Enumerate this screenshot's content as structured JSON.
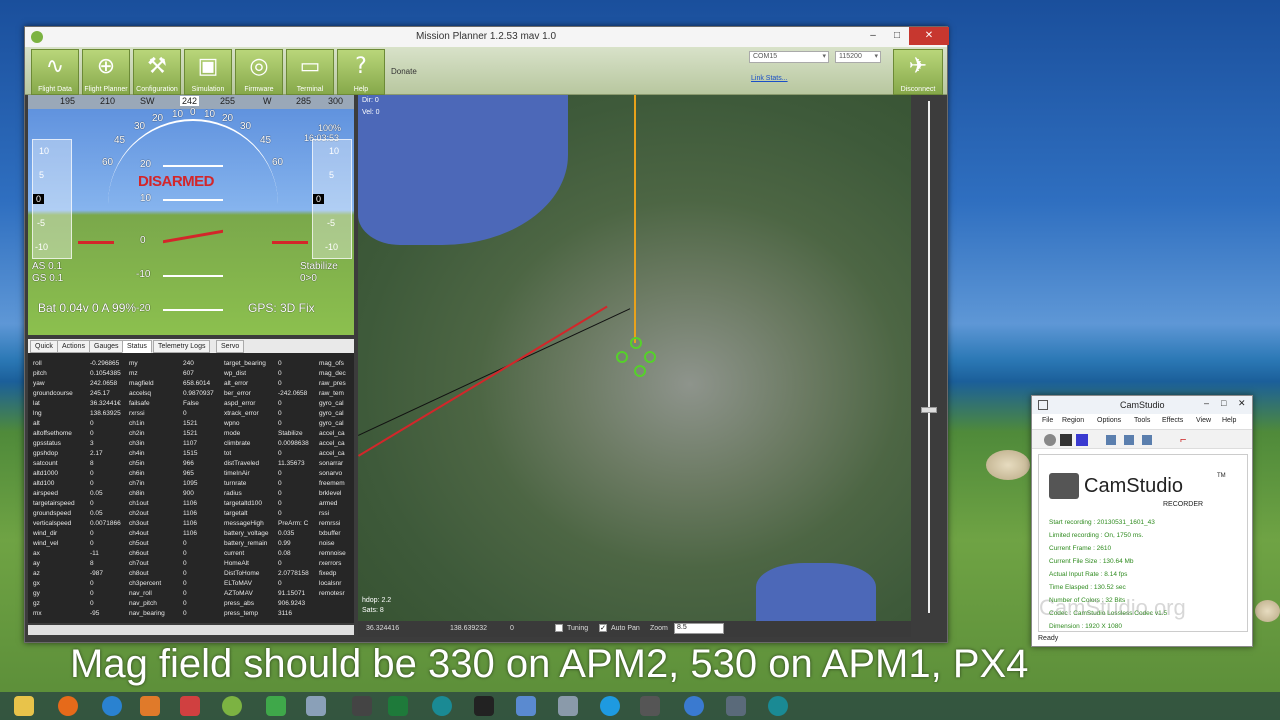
{
  "window": {
    "title": "Mission Planner 1.2.53 mav 1.0",
    "controls": [
      "–",
      "□",
      "✕"
    ]
  },
  "toolbar": {
    "buttons": [
      {
        "label": "Flight Data",
        "icon": "flight-data-icon"
      },
      {
        "label": "Flight Planner",
        "icon": "flight-planner-icon"
      },
      {
        "label": "Configuration",
        "icon": "wrench-icon"
      },
      {
        "label": "Simulation",
        "icon": "simulation-icon"
      },
      {
        "label": "Firmware",
        "icon": "disc-icon"
      },
      {
        "label": "Terminal",
        "icon": "terminal-icon"
      },
      {
        "label": "Help",
        "icon": "help-icon"
      }
    ],
    "donate": "Donate",
    "port": "COM15",
    "baud": "115200",
    "link_stats": "Link Stats...",
    "disconnect": "Disconnect"
  },
  "hud": {
    "heading_ticks": [
      "195",
      "210",
      "SW",
      "242",
      "255",
      "W",
      "285",
      "300"
    ],
    "roll_ticks": [
      "60",
      "45",
      "30",
      "20",
      "10",
      "0",
      "10",
      "20",
      "30",
      "45",
      "60"
    ],
    "pitch_ticks": [
      "20",
      "10",
      "0",
      "-10",
      "-20"
    ],
    "left_tape": [
      "10",
      "5",
      "0",
      "-5",
      "-10"
    ],
    "right_tape": [
      "10",
      "5",
      "0",
      "-5",
      "-10"
    ],
    "battery_pct_top": "100%",
    "time": "16:03:53",
    "disarmed": "DISARMED",
    "as": "AS 0.1",
    "gs": "GS 0.1",
    "mode": "Stabilize",
    "wp": "0>0",
    "battery": "Bat 0.04v 0 A 99%",
    "gps": "GPS: 3D Fix"
  },
  "tabs": [
    "Quick",
    "Actions",
    "Gauges",
    "Status",
    "Telemetry Logs",
    "Servo"
  ],
  "status": {
    "col1_names": [
      "roll",
      "pitch",
      "yaw",
      "groundcourse",
      "lat",
      "lng",
      "alt",
      "altoffsethome",
      "gpsstatus",
      "gpshdop",
      "satcount",
      "altd1000",
      "altd100",
      "airspeed",
      "targetairspeed",
      "groundspeed",
      "verticalspeed",
      "wind_dir",
      "wind_vel",
      "ax",
      "ay",
      "az",
      "gx",
      "gy",
      "gz",
      "mx"
    ],
    "col1_values": [
      "-0.296865",
      "0.1054385",
      "242.0658",
      "245.17",
      "36.32441€",
      "138.63925",
      "0",
      "0",
      "3",
      "2.17",
      "8",
      "0",
      "0",
      "0.05",
      "0",
      "0.05",
      "0.0071866",
      "0",
      "0",
      "-11",
      "8",
      "-987",
      "0",
      "0",
      "0",
      "-95"
    ],
    "col2_names": [
      "my",
      "mz",
      "magfield",
      "accelsq",
      "failsafe",
      "rxrssi",
      "ch1in",
      "ch2in",
      "ch3in",
      "ch4in",
      "ch5in",
      "ch6in",
      "ch7in",
      "ch8in",
      "ch1out",
      "ch2out",
      "ch3out",
      "ch4out",
      "ch5out",
      "ch6out",
      "ch7out",
      "ch8out",
      "ch3percent",
      "nav_roll",
      "nav_pitch",
      "nav_bearing"
    ],
    "col2_values": [
      "240",
      "607",
      "658.6014",
      "0.9870937",
      "False",
      "0",
      "1521",
      "1521",
      "1107",
      "1515",
      "966",
      "965",
      "1095",
      "900",
      "1106",
      "1106",
      "1106",
      "1106",
      "0",
      "0",
      "0",
      "0",
      "0",
      "0",
      "0",
      "0"
    ],
    "col3_names": [
      "target_bearing",
      "wp_dist",
      "alt_error",
      "ber_error",
      "aspd_error",
      "xtrack_error",
      "wpno",
      "mode",
      "climbrate",
      "tot",
      "distTraveled",
      "timeInAir",
      "turnrate",
      "radius",
      "targetaltd100",
      "targetalt",
      "messageHigh",
      "battery_voltage",
      "battery_remain",
      "current",
      "HomeAlt",
      "DistToHome",
      "ELToMAV",
      "AZToMAV",
      "press_abs",
      "press_temp"
    ],
    "col3_values": [
      "0",
      "0",
      "0",
      "-242.0658",
      "0",
      "0",
      "0",
      "Stabilize",
      "0.0098638",
      "0",
      "11.35673",
      "0",
      "0",
      "0",
      "0",
      "0",
      "PreArm: C",
      "0.035",
      "0.99",
      "0.08",
      "0",
      "2.0778158",
      "0",
      "91.15071",
      "906.9243",
      "3116"
    ],
    "col4_names": [
      "mag_ofs",
      "mag_dec",
      "raw_pres",
      "raw_tem",
      "gyro_cal",
      "gyro_cal",
      "gyro_cal",
      "accel_ca",
      "accel_ca",
      "accel_ca",
      "sonarrar",
      "sonarvo",
      "freemem",
      "brklevel",
      "armed",
      "rssi",
      "remrssi",
      "txbuffer",
      "noise",
      "remnoise",
      "rxerrors",
      "fixedp",
      "localsnr",
      "remotesr"
    ]
  },
  "map": {
    "dir": "Dir: 0",
    "vel": "Vel: 0",
    "hdop": "hdop: 2.2",
    "sats": "Sats: 8",
    "lat": "36.324416",
    "lng": "138.639232",
    "alt": "0",
    "tuning": "Tuning",
    "autopan": "Auto Pan",
    "zoom_label": "Zoom",
    "zoom_value": "8.5"
  },
  "camstudio": {
    "title": "CamStudio",
    "menu": [
      "File",
      "Region",
      "Options",
      "Tools",
      "Effects",
      "View",
      "Help"
    ],
    "logo": "CamStudio",
    "tm": "TM",
    "recorder": "RECORDER",
    "info": [
      "Start recording : 20130531_1601_43",
      "Limited recording : On, 1750 ms.",
      "Current Frame : 2610",
      "Current File Size : 130.64 Mb",
      "Actual Input Rate : 8.14 fps",
      "Time Elasped : 130.52 sec",
      "Number of Colors : 32 Bits",
      "Codec : CamStudio Lossless Codec v1.5",
      "Dimension : 1920 X 1080"
    ],
    "watermark": "CamStudio.org",
    "status": "Ready"
  },
  "caption": "Mag field should be 330 on APM2, 530 on APM1, PX4",
  "colors": {
    "accent_green": "#86a84a",
    "disarmed_red": "#d3262a",
    "cam_info_green": "#2f8b1f"
  }
}
